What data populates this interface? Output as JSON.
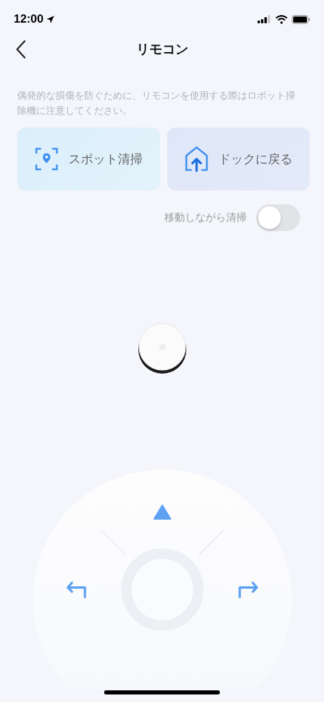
{
  "status_bar": {
    "time": "12:00"
  },
  "nav": {
    "title": "リモコン"
  },
  "notice": "偶発的な損傷を防ぐために、リモコンを使用する際はロボット掃除機に注意してください。",
  "actions": [
    {
      "label": "スポット清掃",
      "kind": "spot"
    },
    {
      "label": "ドックに戻る",
      "kind": "dock"
    }
  ],
  "toggle": {
    "label": "移動しながら清掃",
    "on": false
  }
}
